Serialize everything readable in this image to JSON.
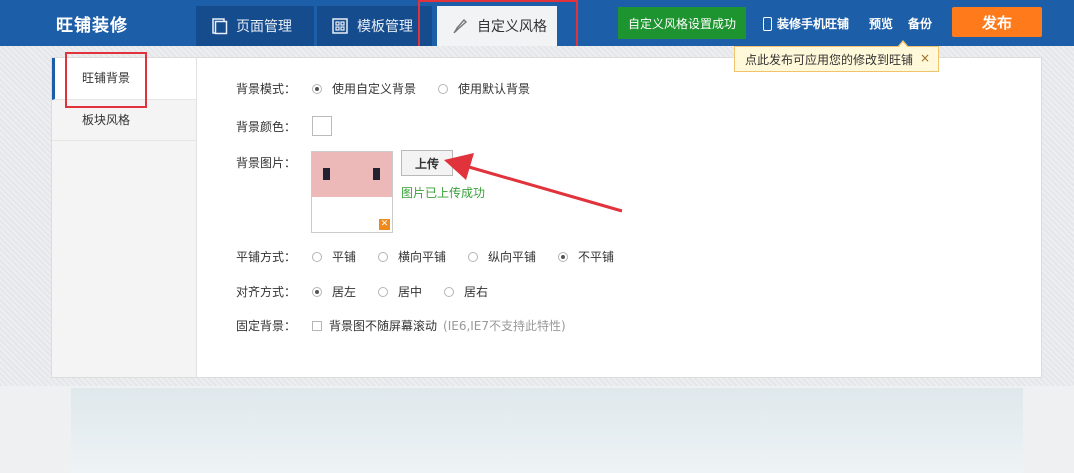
{
  "app": {
    "title": "旺铺装修"
  },
  "tabs": [
    {
      "label": "页面管理",
      "icon": "page-icon",
      "active": false
    },
    {
      "label": "模板管理",
      "icon": "grid-icon",
      "active": false
    },
    {
      "label": "自定义风格",
      "icon": "brush-icon",
      "active": true
    }
  ],
  "header": {
    "status_button": "自定义风格设置成功",
    "mobile_link": "装修手机旺铺",
    "mobile_icon": "mobile-phone-icon",
    "preview": "预览",
    "backup": "备份",
    "publish": "发布"
  },
  "tooltip": {
    "text": "点此发布可应用您的修改到旺铺",
    "close": "×"
  },
  "sidebar": {
    "items": [
      {
        "label": "旺铺背景",
        "active": true
      },
      {
        "label": "板块风格",
        "active": false
      }
    ]
  },
  "form": {
    "bg_mode": {
      "label": "背景模式：",
      "options": [
        {
          "label": "使用自定义背景",
          "checked": true
        },
        {
          "label": "使用默认背景",
          "checked": false
        }
      ]
    },
    "bg_color": {
      "label": "背景颜色：",
      "value": "#ffffff"
    },
    "bg_image": {
      "label": "背景图片：",
      "upload_button": "上传",
      "status": "图片已上传成功",
      "delete_icon": "close-icon"
    },
    "tile": {
      "label": "平铺方式：",
      "options": [
        {
          "label": "平铺",
          "checked": false
        },
        {
          "label": "横向平铺",
          "checked": false
        },
        {
          "label": "纵向平铺",
          "checked": false
        },
        {
          "label": "不平铺",
          "checked": true
        }
      ]
    },
    "align": {
      "label": "对齐方式：",
      "options": [
        {
          "label": "居左",
          "checked": true
        },
        {
          "label": "居中",
          "checked": false
        },
        {
          "label": "居右",
          "checked": false
        }
      ]
    },
    "fixed": {
      "label": "固定背景：",
      "checkbox_label": "背景图不随屏幕滚动",
      "checked": false,
      "hint": "(IE6,IE7不支持此特性)"
    }
  },
  "colors": {
    "topbar": "#1d5ea8",
    "status_green": "#1e9430",
    "publish_orange": "#ff7a1a",
    "annotation_red": "#e0333b",
    "success_green": "#3aa03a"
  }
}
